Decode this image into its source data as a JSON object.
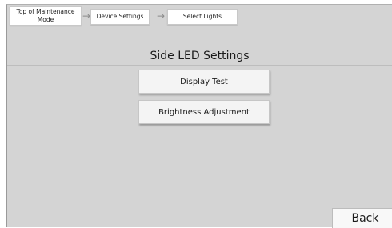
{
  "breadcrumb": {
    "items": [
      {
        "label": "Top of Maintenance\nMode"
      },
      {
        "label": "Device Settings"
      },
      {
        "label": "Select Lights"
      }
    ],
    "separator": "→"
  },
  "page": {
    "title": "Side LED Settings"
  },
  "menu": {
    "display_test": "Display Test",
    "brightness_adjustment": "Brightness Adjustment"
  },
  "footer": {
    "back_label": "Back"
  },
  "colors": {
    "background": "#d4d4d4",
    "button": "#f4f4f4",
    "text": "#1a1a1a"
  }
}
